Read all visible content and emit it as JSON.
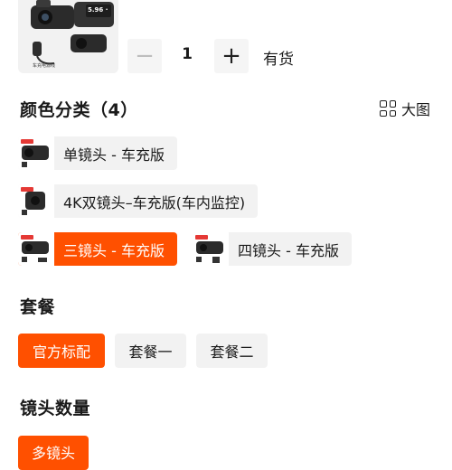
{
  "product_thumb": {
    "caption": "车充电源线",
    "screen_text": "5.96 ·"
  },
  "quantity": {
    "minus_icon": "minus-icon",
    "plus_icon": "plus-icon",
    "minus_label": "−",
    "plus_label": "+",
    "value": "1",
    "stock": "有货"
  },
  "color_section": {
    "title": "颜色分类（4）",
    "bigview_label": "大图",
    "bigview_icon": "grid-icon",
    "options": [
      {
        "label": "单镜头 - 车充版",
        "selected": false
      },
      {
        "label": "4K双镜头–车充版(车内监控)",
        "selected": false
      },
      {
        "label": "三镜头 - 车充版",
        "selected": true
      },
      {
        "label": "四镜头 - 车充版",
        "selected": false
      }
    ]
  },
  "package_section": {
    "title": "套餐",
    "options": [
      {
        "label": "官方标配",
        "selected": true
      },
      {
        "label": "套餐一",
        "selected": false
      },
      {
        "label": "套餐二",
        "selected": false
      }
    ]
  },
  "lens_count_section": {
    "title": "镜头数量",
    "options": [
      {
        "label": "多镜头",
        "selected": true
      }
    ]
  },
  "colors": {
    "accent": "#ff5000",
    "chip_bg": "#f2f2f2",
    "text": "#1a1a1a"
  }
}
